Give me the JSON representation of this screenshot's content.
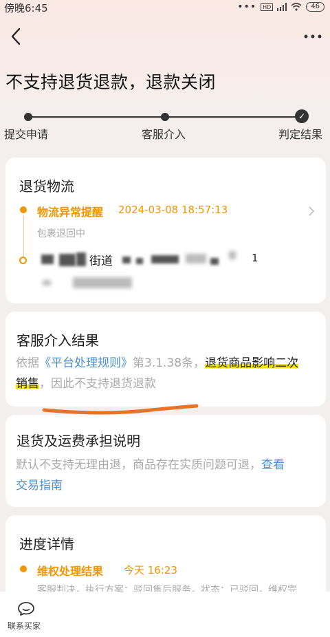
{
  "status_bar": {
    "time": "傍晚6:45",
    "hd": "HD",
    "battery": "46"
  },
  "header": {
    "title": "不支持退货退款，退款关闭"
  },
  "stepper": {
    "steps": [
      "提交申请",
      "客服介入",
      "判定结果"
    ]
  },
  "return_logistics": {
    "title": "退货物流",
    "event_title": "物流异常提醒",
    "event_time": "2024-03-08 18:57:13",
    "event_desc": "包裹退回中",
    "address_word": "街道",
    "address_tail": "1"
  },
  "cs_result": {
    "title": "客服介入结果",
    "text_prefix": "依据",
    "rule_link": "《平台处理规则》",
    "rule_clause": "第3.1.38条，",
    "highlight_1": "退货商品影响二次",
    "highlight_2": "销售",
    "text_suffix": "，因此不支持退货退款"
  },
  "freight": {
    "title": "退货及运费承担说明",
    "text": "默认不支持无理由退，商品存在实质问题可退，",
    "link_1": "查看",
    "link_2": "交易指南"
  },
  "progress": {
    "title": "进度详情",
    "event_title": "维权处理结果",
    "event_time": "今天 16:23",
    "event_desc": "客服判决，执行方案：驳回售后服务，状态：已驳回，维权完"
  },
  "bottom_bar": {
    "contact_label": "联系买家"
  },
  "colors": {
    "accent": "#f39500",
    "link": "#4a8fd0",
    "highlight": "#f5e400",
    "annotation": "#e8742c"
  },
  "icons": [
    "back-arrow-icon",
    "more-icon",
    "chevron-right-icon",
    "chat-bubble-icon",
    "check-icon",
    "wifi-icon",
    "signal-icon"
  ]
}
